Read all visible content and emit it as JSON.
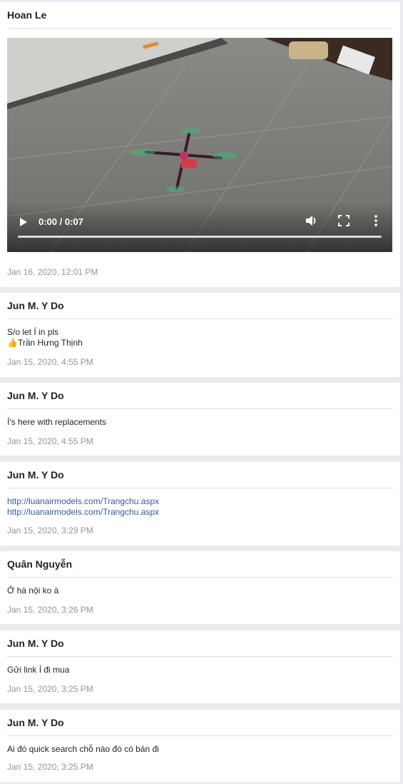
{
  "posts": [
    {
      "author": "Hoan Le",
      "video": {
        "time": "0:00 / 0:07"
      },
      "timestamp": "Jan 16, 2020, 12:01 PM"
    },
    {
      "author": "Jun M. Y Do",
      "lines": [
        "S/o let Í in pls",
        "👍Trần Hưng Thịnh"
      ],
      "timestamp": "Jan 15, 2020, 4:55 PM"
    },
    {
      "author": "Jun M. Y Do",
      "lines": [
        "Í's here with replacements"
      ],
      "timestamp": "Jan 15, 2020, 4:55 PM"
    },
    {
      "author": "Jun M. Y Do",
      "links": [
        "http://luanairmodels.com/Trangchu.aspx",
        "http://luanairmodels.com/Trangchu.aspx"
      ],
      "timestamp": "Jan 15, 2020, 3:29 PM"
    },
    {
      "author": "Quân Nguyễn",
      "lines": [
        "Ở hà nội ko à"
      ],
      "timestamp": "Jan 15, 2020, 3:26 PM"
    },
    {
      "author": "Jun M. Y Do",
      "lines": [
        "Gửi link Í đi mua"
      ],
      "timestamp": "Jan 15, 2020, 3:25 PM"
    },
    {
      "author": "Jun M. Y Do",
      "lines": [
        "Ai đó quick search chỗ nào đó có bán đi"
      ],
      "timestamp": "Jan 15, 2020, 3:25 PM"
    }
  ],
  "icons": {
    "play": "play-icon",
    "volume": "volume-icon",
    "fullscreen": "fullscreen-icon",
    "more": "more-vertical-icon"
  }
}
